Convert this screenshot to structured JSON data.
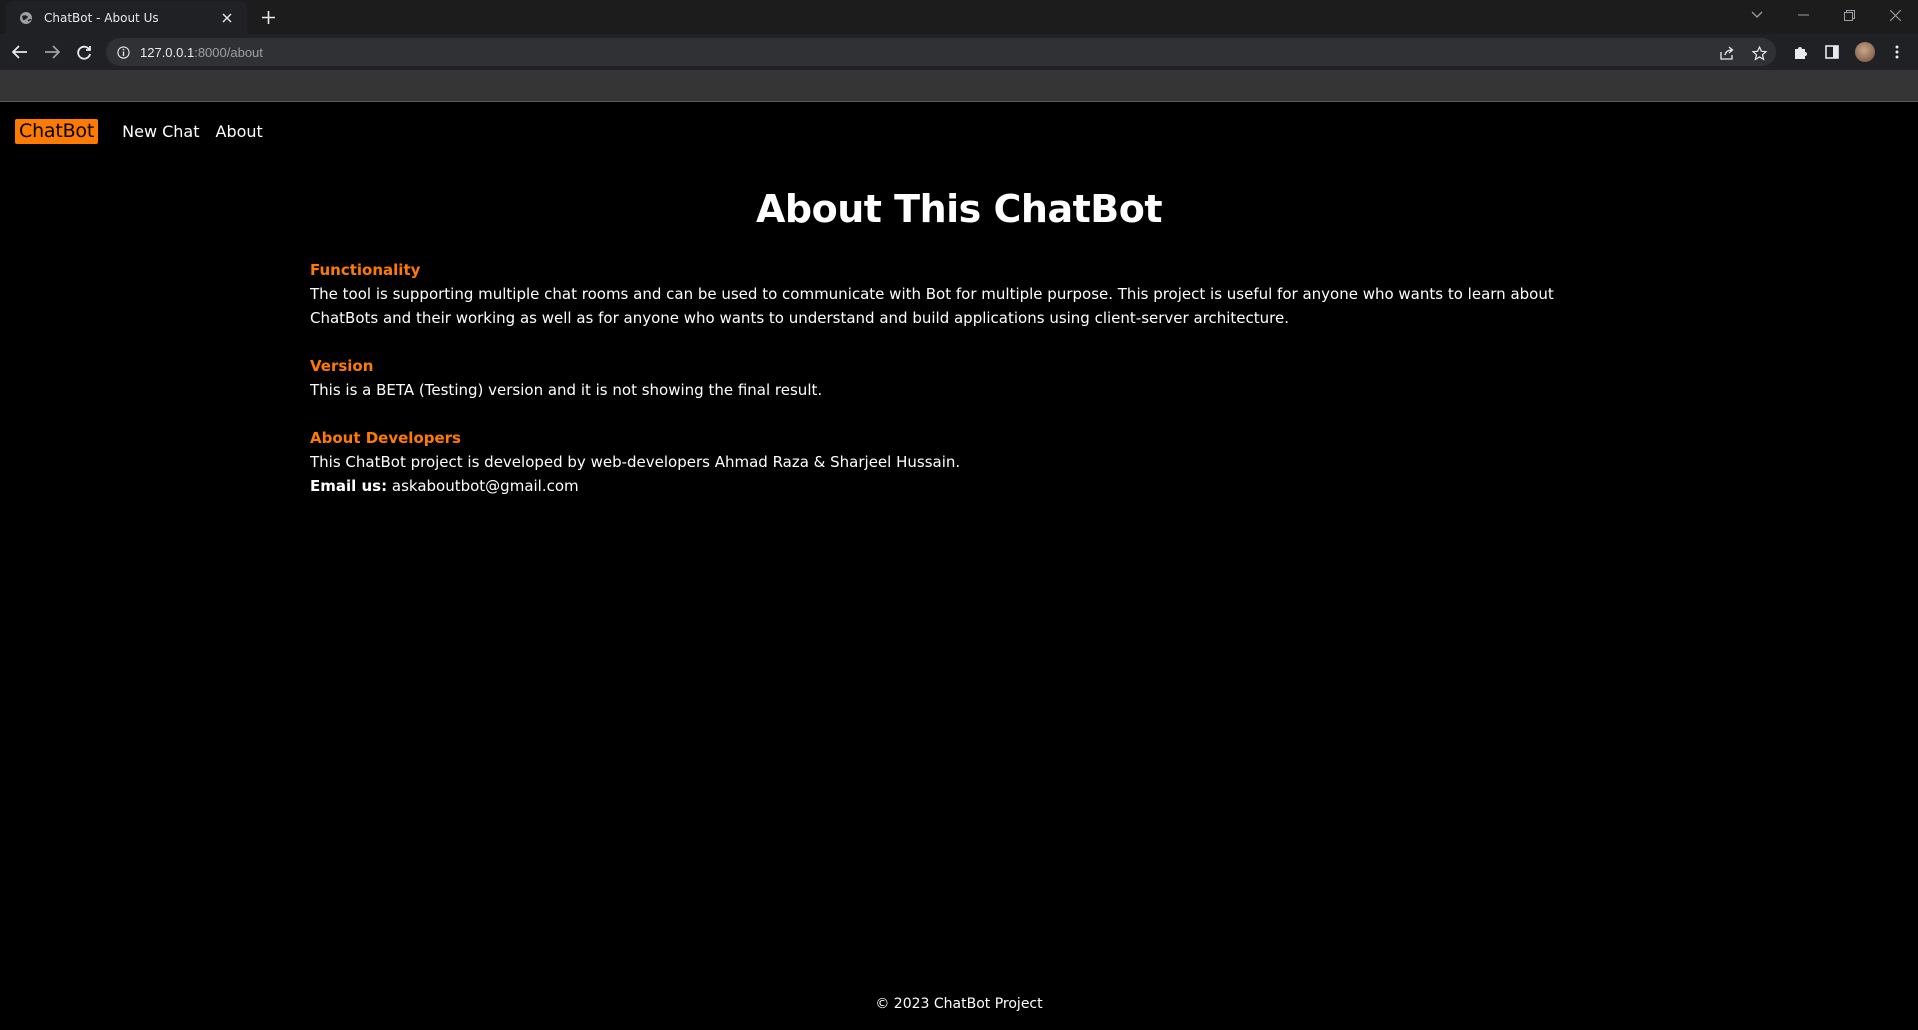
{
  "browser": {
    "tab_title": "ChatBot - About Us",
    "url_host": "127.0.0.1",
    "url_rest": ":8000/about"
  },
  "nav": {
    "brand": "ChatBot",
    "links": [
      "New Chat",
      "About"
    ]
  },
  "main": {
    "heading": "About This ChatBot",
    "sections": [
      {
        "title": "Functionality",
        "text": "The tool is supporting multiple chat rooms and can be used to communicate with Bot for multiple purpose. This project is useful for anyone who wants to learn about ChatBots and their working as well as for anyone who wants to understand and build applications using client-server architecture."
      },
      {
        "title": "Version",
        "text": "This is a BETA (Testing) version and it is not showing the final result."
      },
      {
        "title": "About Developers",
        "text": "This ChatBot project is developed by web-developers Ahmad Raza & Sharjeel Hussain.",
        "email_label": "Email us:",
        "email": "askaboutbot@gmail.com"
      }
    ]
  },
  "footer": {
    "text": "© 2023 ChatBot Project"
  },
  "colors": {
    "accent": "#ff7a00",
    "background": "#000000",
    "text": "#ffffff"
  }
}
